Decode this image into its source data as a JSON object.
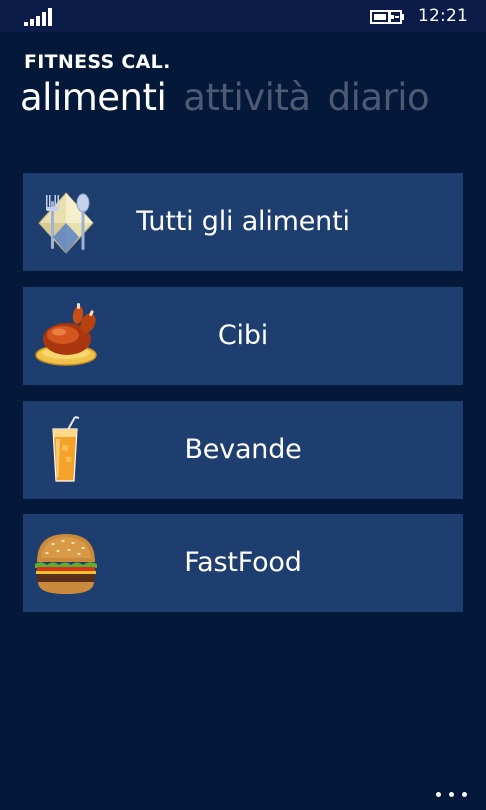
{
  "status_bar": {
    "time": "12:21",
    "signal_icon": "signal-icon",
    "battery_icon": "battery-charging-icon"
  },
  "header": {
    "app_title": "FITNESS CAL.",
    "tabs": [
      {
        "label": "alimenti",
        "active": true
      },
      {
        "label": "attività",
        "active": false
      },
      {
        "label": "diario",
        "active": false
      }
    ]
  },
  "menu": {
    "items": [
      {
        "label": "Tutti gli alimenti",
        "icon": "cutlery-icon"
      },
      {
        "label": "Cibi",
        "icon": "roast-chicken-icon"
      },
      {
        "label": "Bevande",
        "icon": "drink-glass-icon"
      },
      {
        "label": "FastFood",
        "icon": "hamburger-icon"
      }
    ]
  },
  "app_bar": {
    "more_icon": "more-icon"
  },
  "colors": {
    "background": "#04183a",
    "status_bar": "#0a1c47",
    "tile": "#1d3e6e",
    "inactive_tab": "#4e5a72"
  }
}
